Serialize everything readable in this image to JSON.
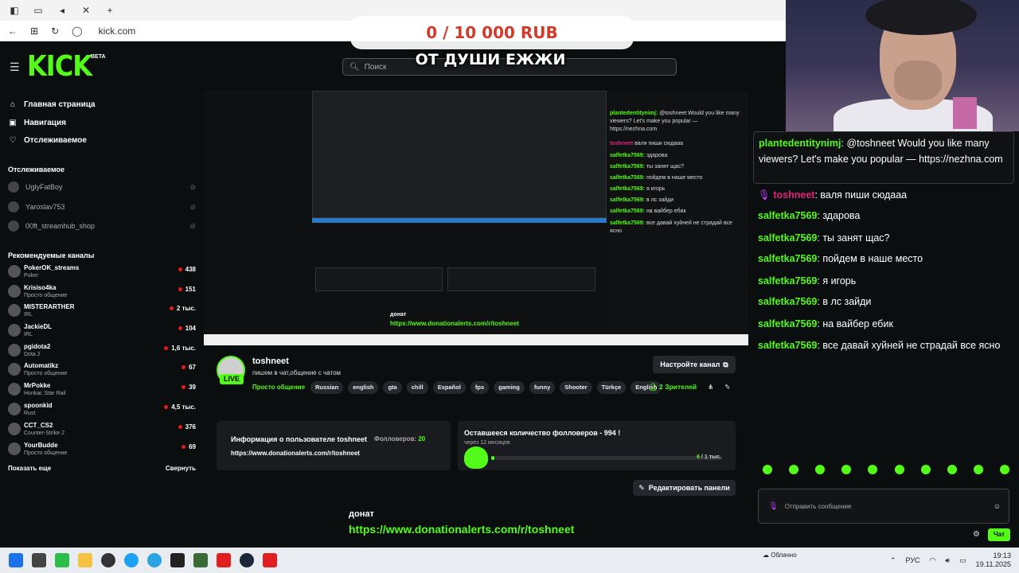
{
  "browser": {
    "url": "kick.com"
  },
  "overlay": {
    "donation_goal": "0 / 10 000 RUB",
    "stream_title": "ОТ ДУШИ ЕЖЖИ"
  },
  "header": {
    "logo": "KICK",
    "logo_badge": "BETA",
    "search_placeholder": "Поиск"
  },
  "sidebar": {
    "nav": [
      {
        "label": "Главная страница",
        "icon": "home-icon"
      },
      {
        "label": "Навигация",
        "icon": "compass-icon"
      },
      {
        "label": "Отслеживаемое",
        "icon": "heart-icon"
      }
    ],
    "followed_title": "Отслеживаемое",
    "followed": [
      {
        "name": "UglyFatBoy",
        "status": "offline"
      },
      {
        "name": "Yaroslav753",
        "status": "offline"
      },
      {
        "name": "00ft_streamhub_shop",
        "status": "offline"
      }
    ],
    "recommended_title": "Рекомендуемые каналы",
    "recommended": [
      {
        "name": "PokerOK_streams",
        "category": "Poker",
        "viewers": "438"
      },
      {
        "name": "Krisiso4ka",
        "category": "Просто общение",
        "viewers": "151"
      },
      {
        "name": "MISTERARTHER",
        "category": "IRL",
        "viewers": "2 тыс."
      },
      {
        "name": "JackieDL",
        "category": "IRL",
        "viewers": "104"
      },
      {
        "name": "pgidota2",
        "category": "Dota 2",
        "viewers": "1,6 тыс."
      },
      {
        "name": "Automatikz",
        "category": "Просто общение",
        "viewers": "67"
      },
      {
        "name": "MrPokke",
        "category": "Honkai: Star Rail",
        "viewers": "39"
      },
      {
        "name": "spoonkid",
        "category": "Rust",
        "viewers": "4,5 тыс."
      },
      {
        "name": "CCT_CS2",
        "category": "Counter-Strike 2",
        "viewers": "376"
      },
      {
        "name": "YourBudde",
        "category": "Просто общение",
        "viewers": "69"
      }
    ],
    "show_more": "Показать еще",
    "collapse": "Свернуть"
  },
  "channel": {
    "name": "toshneet",
    "live_badge": "LIVE",
    "title": "пишем в чат,общение с чатом",
    "category": "Просто общение",
    "tags": [
      "Russian",
      "english",
      "gta",
      "chill",
      "Español",
      "fps",
      "gaming",
      "funny",
      "Shooter",
      "Türkçe",
      "English"
    ],
    "setup_button": "Настройте канал",
    "viewers_count": "2",
    "viewers_label": "Зрителей",
    "edit_panels_button": "Редактировать панели"
  },
  "panels": {
    "user_info_title": "Информация о пользователе toshneet",
    "followers_label": "Фолловеров:",
    "followers_value": "20",
    "user_info_link": "https://www.donationalerts.com/r/toshneet",
    "goal_title": "Оставшееся количество фолловеров - 994 !",
    "goal_subtitle": "через 12 месяцев",
    "goal_count_current": "6",
    "goal_count_total": "/ 1 тыс.",
    "goal_progress": 0.006
  },
  "donat": {
    "label": "донат",
    "link": "https://www.donationalerts.com/r/toshneet"
  },
  "chat": {
    "pinned": {
      "nick": "plantedentitynimj",
      "text": "@toshneet Would you like many viewers? Let's make you popular — https://nezhna.com"
    },
    "messages": [
      {
        "nick": "toshneet",
        "text": "валя пиши сюдааа",
        "style": "host"
      },
      {
        "nick": "salfetka7569",
        "text": "здарова",
        "style": "normal"
      },
      {
        "nick": "salfetka7569",
        "text": "ты занят щас?",
        "style": "normal"
      },
      {
        "nick": "salfetka7569",
        "text": "пойдем в наше место",
        "style": "normal"
      },
      {
        "nick": "salfetka7569",
        "text": "я игорь",
        "style": "normal"
      },
      {
        "nick": "salfetka7569",
        "text": "в лс зайди",
        "style": "normal"
      },
      {
        "nick": "salfetka7569",
        "text": "на вайбер ебик",
        "style": "normal"
      },
      {
        "nick": "salfetka7569",
        "text": "все давай хуйней не страдай все ясно",
        "style": "normal"
      }
    ],
    "input_placeholder": "Отправить сообщение",
    "send_button": "Чат"
  },
  "nested_preview": {
    "chat_lines": [
      {
        "nick": "plantedentitynimj:",
        "text": "@toshneet Would you like many viewers? Let's make you popular — https://nezhna.com"
      },
      {
        "nick": "toshneet",
        "text": "валя пиши сюдааа"
      },
      {
        "nick": "salfetka7569:",
        "text": "здарова"
      },
      {
        "nick": "salfetka7569:",
        "text": "ты занят щас?"
      },
      {
        "nick": "salfetka7569:",
        "text": "пойдем в наше место"
      },
      {
        "nick": "salfetka7569:",
        "text": "я игорь"
      },
      {
        "nick": "salfetka7569:",
        "text": "в лс зайди"
      },
      {
        "nick": "salfetka7569:",
        "text": "на вайбер ебик"
      },
      {
        "nick": "salfetka7569:",
        "text": "все давай хуйней не страдай все ясно"
      }
    ],
    "donat_label": "донат",
    "donat_link": "https://www.donationalerts.com/r/toshneet"
  },
  "taskbar": {
    "weather_label": "Облачно",
    "lang": "РУС",
    "time": "19:13",
    "date": "19.11.2025"
  }
}
